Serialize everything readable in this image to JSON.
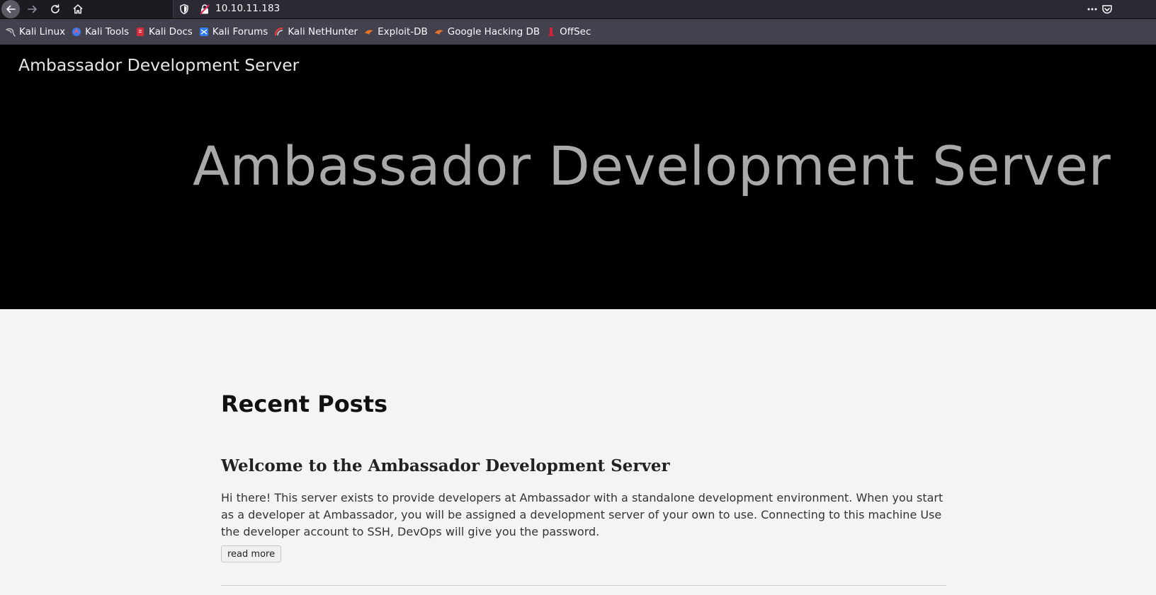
{
  "browser": {
    "url": "10.10.11.183",
    "bookmarks": [
      {
        "label": "Kali Linux",
        "icon": "kali-dragon-icon"
      },
      {
        "label": "Kali Tools",
        "icon": "kali-tools-icon"
      },
      {
        "label": "Kali Docs",
        "icon": "kali-docs-icon"
      },
      {
        "label": "Kali Forums",
        "icon": "kali-forums-icon"
      },
      {
        "label": "Kali NetHunter",
        "icon": "kali-nethunter-icon"
      },
      {
        "label": "Exploit-DB",
        "icon": "exploit-db-icon"
      },
      {
        "label": "Google Hacking DB",
        "icon": "ghdb-icon"
      },
      {
        "label": "OffSec",
        "icon": "offsec-icon"
      }
    ],
    "colors": {
      "toolbar": "#1c1b22",
      "urlbar": "#2b2a33",
      "bookmarks_bar": "#42414d"
    }
  },
  "site": {
    "nav_title": "Ambassador Development Server",
    "hero_title": "Ambassador Development Server"
  },
  "main": {
    "section_heading": "Recent Posts",
    "posts": [
      {
        "title": "Welcome to the Ambassador Development Server",
        "excerpt": "Hi there! This server exists to provide developers at Ambassador with a standalone development environment. When you start as a developer at Ambassador, you will be assigned a development server of your own to use. Connecting to this machine Use the developer account to SSH, DevOps will give you the password.",
        "read_more_label": "read more"
      }
    ]
  }
}
